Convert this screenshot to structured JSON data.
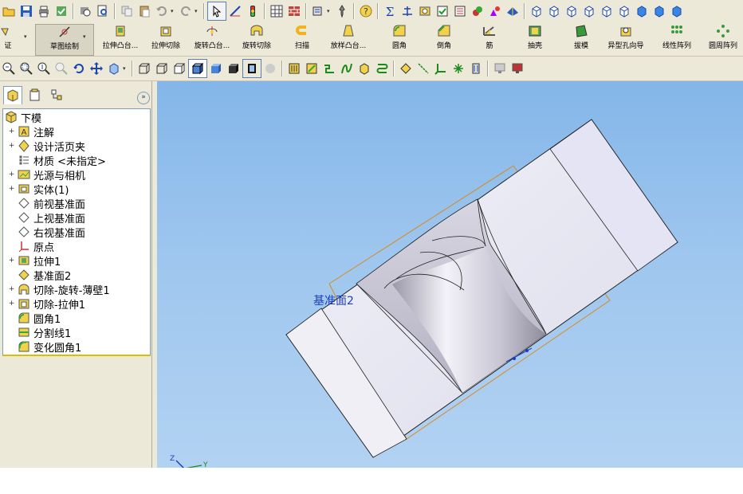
{
  "toolbar_top": {
    "icons": [
      "open-icon",
      "save-icon",
      "print-icon",
      "rebuild-icon",
      "print-preview-icon",
      "copy-icon",
      "paste-icon",
      "undo-icon",
      "redo-icon",
      "select-icon",
      "sketch-icon",
      "traffic-light-icon",
      "grid-icon",
      "brick-icon",
      "options-icon",
      "pin-icon",
      "help-icon",
      "sum-icon",
      "spline-icon",
      "feature-icon",
      "check-icon",
      "list-icon",
      "appearance-icon",
      "edit-appearance-icon",
      "view-cube-1",
      "view-cube-2",
      "view-cube-3",
      "view-cube-4",
      "view-cube-5",
      "view-cube-6",
      "view-cube-7",
      "view-cube-8"
    ]
  },
  "features_toolbar": {
    "items": [
      {
        "label": "证"
      },
      {
        "label": "草图绘制"
      },
      {
        "label": "拉伸凸台..."
      },
      {
        "label": "拉伸切除"
      },
      {
        "label": "旋转凸台..."
      },
      {
        "label": "旋转切除"
      },
      {
        "label": "扫描"
      },
      {
        "label": "放样凸台..."
      },
      {
        "label": "圆角"
      },
      {
        "label": "倒角"
      },
      {
        "label": "筋"
      },
      {
        "label": "抽壳"
      },
      {
        "label": "拔模"
      },
      {
        "label": "异型孔向导"
      },
      {
        "label": "线性阵列"
      },
      {
        "label": "圆周阵列"
      }
    ]
  },
  "view_toolbar": {
    "icons": [
      "zoom-fit-icon",
      "zoom-area-icon",
      "zoom-in-out-icon",
      "zoom-selection-icon",
      "rotate-icon",
      "pan-icon",
      "standard-views-icon",
      "wireframe-icon",
      "hidden-lines-visible-icon",
      "hidden-lines-removed-icon",
      "shaded-with-edges-icon",
      "shaded-icon",
      "shadows-icon",
      "perspective-icon",
      "extrude-surface-icon",
      "planar-surface-icon",
      "split-line-icon",
      "curve-icon",
      "feature-icon",
      "composite-icon",
      "plane-icon",
      "axis-icon",
      "coordinate-icon",
      "point-icon",
      "mate-reference-icon",
      "display-icon",
      "render-icon"
    ]
  },
  "feature_tree": {
    "root": "下模",
    "items": [
      {
        "label": "注解",
        "expandable": true,
        "icon": "annotations-icon"
      },
      {
        "label": "设计活页夹",
        "expandable": true,
        "icon": "design-binder-icon"
      },
      {
        "label": "材质 <未指定>",
        "expandable": false,
        "icon": "material-icon"
      },
      {
        "label": "光源与相机",
        "expandable": true,
        "icon": "lights-icon"
      },
      {
        "label": "实体(1)",
        "expandable": true,
        "icon": "solid-bodies-icon"
      },
      {
        "label": "前视基准面",
        "expandable": false,
        "icon": "plane-icon"
      },
      {
        "label": "上视基准面",
        "expandable": false,
        "icon": "plane-icon"
      },
      {
        "label": "右视基准面",
        "expandable": false,
        "icon": "plane-icon"
      },
      {
        "label": "原点",
        "expandable": false,
        "icon": "origin-icon"
      },
      {
        "label": "拉伸1",
        "expandable": true,
        "icon": "extrude-icon"
      },
      {
        "label": "基准面2",
        "expandable": false,
        "icon": "plane-yellow-icon"
      },
      {
        "label": "切除-旋转-薄壁1",
        "expandable": true,
        "icon": "revolve-cut-icon"
      },
      {
        "label": "切除-拉伸1",
        "expandable": true,
        "icon": "extrude-cut-icon"
      },
      {
        "label": "圆角1",
        "expandable": false,
        "icon": "fillet-icon"
      },
      {
        "label": "分割线1",
        "expandable": false,
        "icon": "split-line-icon"
      },
      {
        "label": "变化圆角1",
        "expandable": false,
        "icon": "variable-fillet-icon"
      }
    ]
  },
  "viewport": {
    "plane_label": "基准面2",
    "triad_z": "Z",
    "triad_y": "Y"
  },
  "colors": {
    "ui_face": "#ece9d8",
    "viewport_top": "#84b6e9",
    "plane_edge": "#d98a1e",
    "label_blue": "#1b3fbf"
  }
}
